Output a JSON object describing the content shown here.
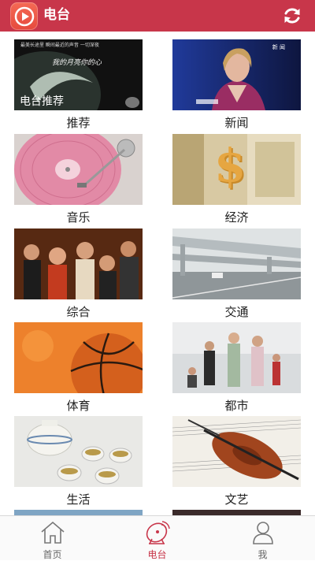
{
  "header": {
    "title": "电台"
  },
  "colors": {
    "brand": "#c8364a"
  },
  "tiles": [
    {
      "label": "推荐",
      "thumb_caption": "电台推荐",
      "thumb_lyric": "我的月亮你的心",
      "thumb_small": "最美长途里 瞬间最近的声音 一切深夜"
    },
    {
      "label": "新闻",
      "thumb_badge": "新 闻"
    },
    {
      "label": "音乐"
    },
    {
      "label": "经济"
    },
    {
      "label": "综合"
    },
    {
      "label": "交通"
    },
    {
      "label": "体育"
    },
    {
      "label": "都市"
    },
    {
      "label": "生活"
    },
    {
      "label": "文艺"
    }
  ],
  "tabs": [
    {
      "label": "首页",
      "icon": "home-icon"
    },
    {
      "label": "电台",
      "icon": "radio-dish-icon",
      "active": true
    },
    {
      "label": "我",
      "icon": "person-icon"
    }
  ]
}
